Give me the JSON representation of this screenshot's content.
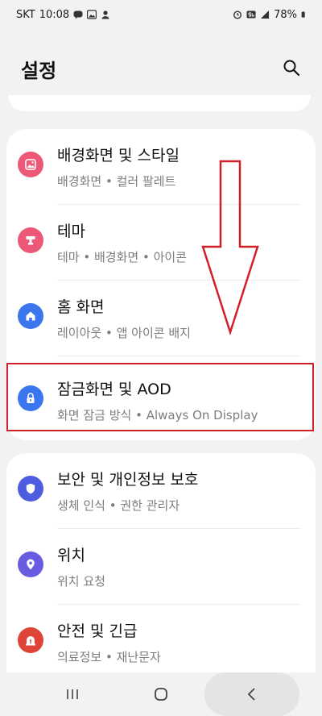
{
  "status_bar": {
    "carrier": "SKT",
    "time": "10:08",
    "battery": "78%"
  },
  "header": {
    "title": "설정"
  },
  "groups": [
    {
      "items": [
        {
          "title": "배경화면 및 스타일",
          "subtitle": "배경화면 • 컬러 팔레트",
          "icon": "wallpaper-icon",
          "color": "#ee5878"
        },
        {
          "title": "테마",
          "subtitle": "테마 • 배경화면 • 아이콘",
          "icon": "theme-icon",
          "color": "#ee5878"
        },
        {
          "title": "홈 화면",
          "subtitle": "레이아웃 • 앱 아이콘 배지",
          "icon": "home-icon",
          "color": "#3b76ee"
        },
        {
          "title": "잠금화면 및 AOD",
          "subtitle": "화면 잠금 방식 • Always On Display",
          "icon": "lock-icon",
          "color": "#3b76ee"
        }
      ]
    },
    {
      "items": [
        {
          "title": "보안 및 개인정보 보호",
          "subtitle": "생체 인식 • 권한 관리자",
          "icon": "shield-icon",
          "color": "#4e5ce0"
        },
        {
          "title": "위치",
          "subtitle": "위치 요청",
          "icon": "location-pin-icon",
          "color": "#6a5ce0"
        },
        {
          "title": "안전 및 긴급",
          "subtitle": "의료정보 • 재난문자",
          "icon": "emergency-icon",
          "color": "#df4438"
        }
      ]
    }
  ],
  "annotations": {
    "highlight_color": "#d0202a"
  }
}
